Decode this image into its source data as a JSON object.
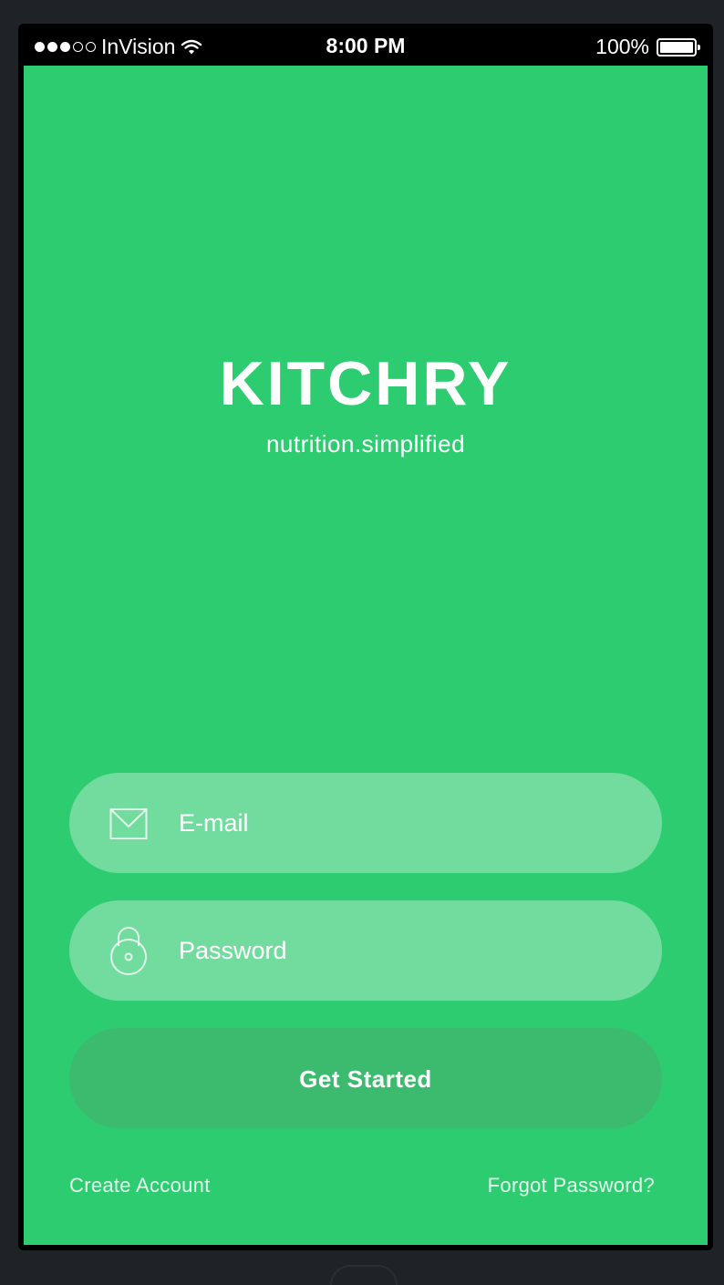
{
  "status_bar": {
    "carrier": "InVision",
    "time": "8:00 PM",
    "battery": "100%",
    "signal_bars_filled": 3,
    "signal_bars_total": 5
  },
  "brand": {
    "name": "KITCHRY",
    "tagline": "nutrition.simplified"
  },
  "form": {
    "email_placeholder": "E-mail",
    "password_placeholder": "Password",
    "submit_label": "Get Started"
  },
  "footer": {
    "create_account": "Create Account",
    "forgot_password": "Forgot Password?"
  },
  "colors": {
    "background": "#2ecc71",
    "button": "#3cbb6f",
    "field": "rgba(255,255,255,0.32)",
    "text": "#ffffff"
  },
  "icons": {
    "email_field": "envelope-icon",
    "password_field": "padlock-icon",
    "status_wifi": "wifi-icon",
    "status_battery": "battery-icon"
  }
}
